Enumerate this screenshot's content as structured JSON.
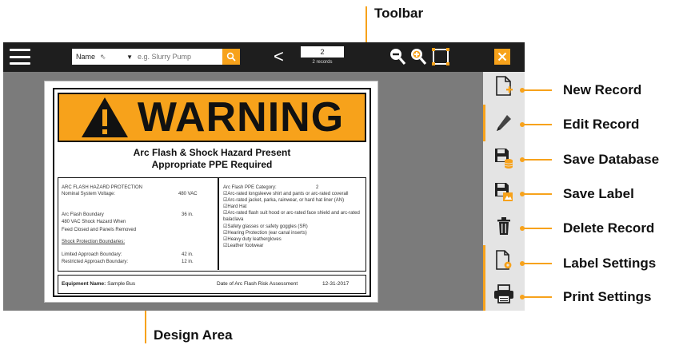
{
  "callouts": {
    "toolbar": "Toolbar",
    "design_area": "Design Area",
    "new_record": "New Record",
    "edit_record": "Edit Record",
    "save_database": "Save Database",
    "save_label": "Save Label",
    "delete_record": "Delete Record",
    "label_settings": "Label Settings",
    "print_settings": "Print Settings"
  },
  "toolbar": {
    "search_field": "Name",
    "search_placeholder": "e.g. Slurry Pump",
    "record_number": "2",
    "record_count": "2 records"
  },
  "label": {
    "warning_word": "WARNING",
    "hazard_line1": "Arc Flash & Shock Hazard Present",
    "hazard_line2": "Appropriate PPE Required",
    "left": {
      "section_title": "ARC FLASH HAZARD PROTECTION",
      "nominal_voltage_label": "Nominal System Voltage:",
      "nominal_voltage_value": "480 VAC",
      "boundary_label": "Arc Flash Boundary",
      "boundary_value": "36 in.",
      "shock_note_1": "480 VAC Shock Hazard When",
      "shock_note_2": "Feed Closed and Panels Removed",
      "shock_boundaries_title": "Shock Protection Boundaries:",
      "limited_label": "Limited Approach Boundary:",
      "limited_value": "42 in.",
      "restricted_label": "Restricted Approach Boundary:",
      "restricted_value": "12 in."
    },
    "right": {
      "ppe_category_label": "Arc Flash PPE Category:",
      "ppe_category_value": "2",
      "items": [
        "☑Arc-rated longsleeve shirt and pants or arc-rated coverall",
        "☑Arc-rated jacket, parka, rainwear, or hard hat liner (AN)",
        "☑Hard Hat",
        "☑Arc-rated flash suit hood or arc-rated face shield and arc-rated balaclava",
        "☑Safety glasses or safety goggles (SR)",
        "☑Hearing Protection (ear canal inserts)",
        "☑Heavy duty leathergloves",
        "☑Leather footwear"
      ]
    },
    "footer": {
      "equipment_label": "Equipment Name:",
      "equipment_value": "Sample Bus",
      "date_label": "Date of Arc Flash Risk Assessment",
      "date_value": "12-31-2017"
    }
  },
  "colors": {
    "accent": "#f7a21b",
    "toolbar_bg": "#1e1e1e",
    "canvas_bg": "#7b7b7b",
    "sidebar_bg": "#e4e4e4"
  }
}
